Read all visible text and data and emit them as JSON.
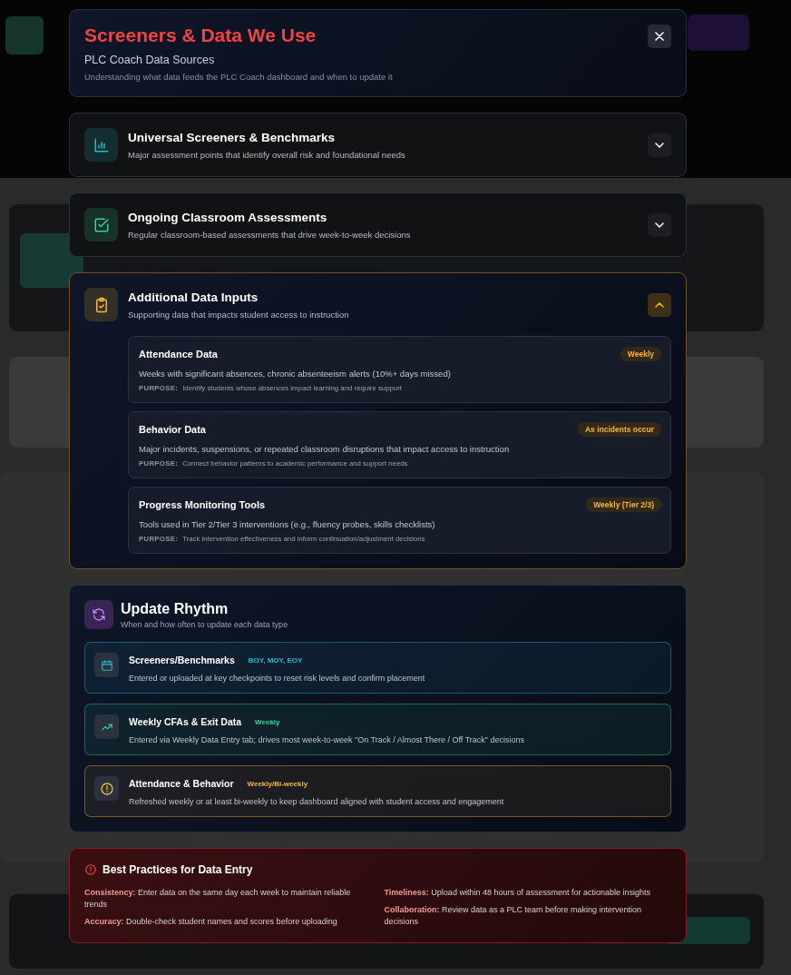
{
  "modal": {
    "title": "Screeners & Data We Use",
    "subtitle": "PLC Coach Data Sources",
    "description": "Understanding what data feeds the PLC Coach dashboard and when to update it"
  },
  "sections": [
    {
      "title": "Universal Screeners & Benchmarks",
      "description": "Major assessment points that identify overall risk and foundational needs",
      "color": "#22b8cf",
      "expanded": false
    },
    {
      "title": "Ongoing Classroom Assessments",
      "description": "Regular classroom-based assessments that drive week-to-week decisions",
      "color": "#34d399",
      "expanded": false
    },
    {
      "title": "Additional Data Inputs",
      "description": "Supporting data that impacts student access to instruction",
      "color": "#f5b82e",
      "expanded": true,
      "items": [
        {
          "title": "Attendance Data",
          "frequency": "Weekly",
          "description": "Weeks with significant absences, chronic absenteeism alerts (10%+ days missed)",
          "purpose_label": "PURPOSE:",
          "purpose": "Identify students whose absences impact learning and require support"
        },
        {
          "title": "Behavior Data",
          "frequency": "As incidents occur",
          "description": "Major incidents, suspensions, or repeated classroom disruptions that impact access to instruction",
          "purpose_label": "PURPOSE:",
          "purpose": "Connect behavior patterns to academic performance and support needs"
        },
        {
          "title": "Progress Monitoring Tools",
          "frequency": "Weekly (Tier 2/3)",
          "description": "Tools used in Tier 2/Tier 3 interventions (e.g., fluency probes, skills checklists)",
          "purpose_label": "PURPOSE:",
          "purpose": "Track intervention effectiveness and inform continuation/adjustment decisions"
        }
      ]
    }
  ],
  "update_rhythm": {
    "title": "Update Rhythm",
    "subtitle": "When and how often to update each data type",
    "items": [
      {
        "title": "Screeners/Benchmarks",
        "frequency": "BOY, MOY, EOY",
        "description": "Entered or uploaded at key checkpoints to reset risk levels and confirm placement",
        "color": "#22b8cf"
      },
      {
        "title": "Weekly CFAs & Exit Data",
        "frequency": "Weekly",
        "description": "Entered via Weekly Data Entry tab; drives most week-to-week \"On Track / Almost There / Off Track\" decisions",
        "color": "#34d399"
      },
      {
        "title": "Attendance & Behavior",
        "frequency": "Weekly/Bi-weekly",
        "description": "Refreshed weekly or at least bi-weekly to keep dashboard aligned with student access and engagement",
        "color": "#f5b82e"
      }
    ]
  },
  "best_practices": {
    "title": "Best Practices for Data Entry",
    "columns": [
      [
        "**Consistency:** Enter data on the same day each week to maintain reliable trends",
        "**Accuracy:** Double-check student names and scores before uploading"
      ],
      [
        "**Timeliness:** Upload within 48 hours of assessment for actionable insights",
        "**Collaboration:** Review data as a PLC team before making intervention decisions"
      ]
    ]
  }
}
